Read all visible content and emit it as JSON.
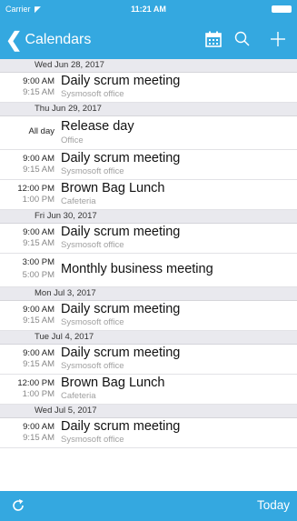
{
  "status": {
    "carrier": "Carrier",
    "time": "11:21 AM"
  },
  "nav": {
    "back_label": "Calendars"
  },
  "icons": {
    "back": "chevron-left-icon",
    "calendar": "calendar-icon",
    "search": "search-icon",
    "add": "plus-icon",
    "refresh": "refresh-icon"
  },
  "colors": {
    "accent": "#34a8e0",
    "header_bg": "#e9e9ee"
  },
  "days": [
    {
      "header": "Wed  Jun 28, 2017",
      "events": [
        {
          "start": "9:00 AM",
          "end": "9:15 AM",
          "title": "Daily scrum meeting",
          "location": "Sysmosoft office"
        }
      ]
    },
    {
      "header": "Thu  Jun 29, 2017",
      "events": [
        {
          "allday": "All day",
          "title": "Release day",
          "location": "Office"
        },
        {
          "start": "9:00 AM",
          "end": "9:15 AM",
          "title": "Daily scrum meeting",
          "location": "Sysmosoft office"
        },
        {
          "start": "12:00 PM",
          "end": "1:00 PM",
          "title": "Brown Bag Lunch",
          "location": "Cafeteria"
        }
      ]
    },
    {
      "header": "Fri  Jun 30, 2017",
      "events": [
        {
          "start": "9:00 AM",
          "end": "9:15 AM",
          "title": "Daily scrum meeting",
          "location": "Sysmosoft office"
        },
        {
          "start": "3:00 PM",
          "end": "5:00 PM",
          "title": "Monthly business meeting",
          "location": ""
        }
      ]
    },
    {
      "header": "Mon  Jul 3, 2017",
      "events": [
        {
          "start": "9:00 AM",
          "end": "9:15 AM",
          "title": "Daily scrum meeting",
          "location": "Sysmosoft office"
        }
      ]
    },
    {
      "header": "Tue  Jul 4, 2017",
      "events": [
        {
          "start": "9:00 AM",
          "end": "9:15 AM",
          "title": "Daily scrum meeting",
          "location": "Sysmosoft office"
        },
        {
          "start": "12:00 PM",
          "end": "1:00 PM",
          "title": "Brown Bag Lunch",
          "location": "Cafeteria"
        }
      ]
    },
    {
      "header": "Wed  Jul 5, 2017",
      "events": [
        {
          "start": "9:00 AM",
          "end": "9:15 AM",
          "title": "Daily scrum meeting",
          "location": "Sysmosoft office"
        }
      ]
    }
  ],
  "toolbar": {
    "today_label": "Today"
  }
}
